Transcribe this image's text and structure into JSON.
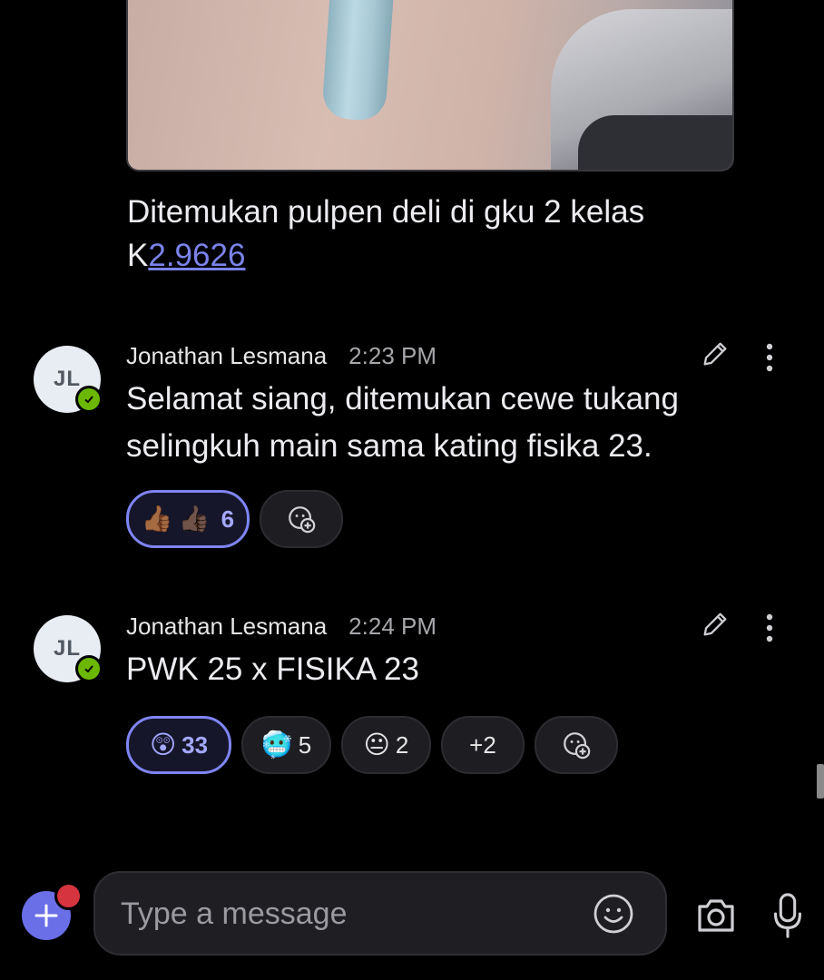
{
  "first_post": {
    "caption_text": "Ditemukan pulpen deli di gku 2 kelas K",
    "caption_link": "2.9626"
  },
  "messages": [
    {
      "avatar_initials": "JL",
      "author": "Jonathan Lesmana",
      "time": "2:23 PM",
      "text": "Selamat siang, ditemukan cewe tukang selingkuh main sama kating fisika 23.",
      "reactions": [
        {
          "emoji": "👍🏾",
          "emoji2": "👍🏿",
          "count": "6",
          "active": true
        }
      ]
    },
    {
      "avatar_initials": "JL",
      "author": "Jonathan Lesmana",
      "time": "2:24 PM",
      "text": "PWK 25 x FISIKA 23",
      "reactions": [
        {
          "emoji": "😲",
          "count": "33",
          "active": true
        },
        {
          "emoji": "🥶",
          "count": "5",
          "active": false
        },
        {
          "emoji": "😐",
          "count": "2",
          "active": false
        },
        {
          "label": "+2",
          "active": false
        }
      ]
    }
  ],
  "composer": {
    "placeholder": "Type a message"
  },
  "colors": {
    "accent": "#7f85f5",
    "presence": "#6bb700",
    "badge": "#d6353f",
    "background": "#000000"
  },
  "icons": [
    "edit-icon",
    "more-icon",
    "add-reaction-icon",
    "emoji-icon",
    "camera-icon",
    "microphone-icon",
    "plus-icon",
    "checkmark-icon"
  ]
}
